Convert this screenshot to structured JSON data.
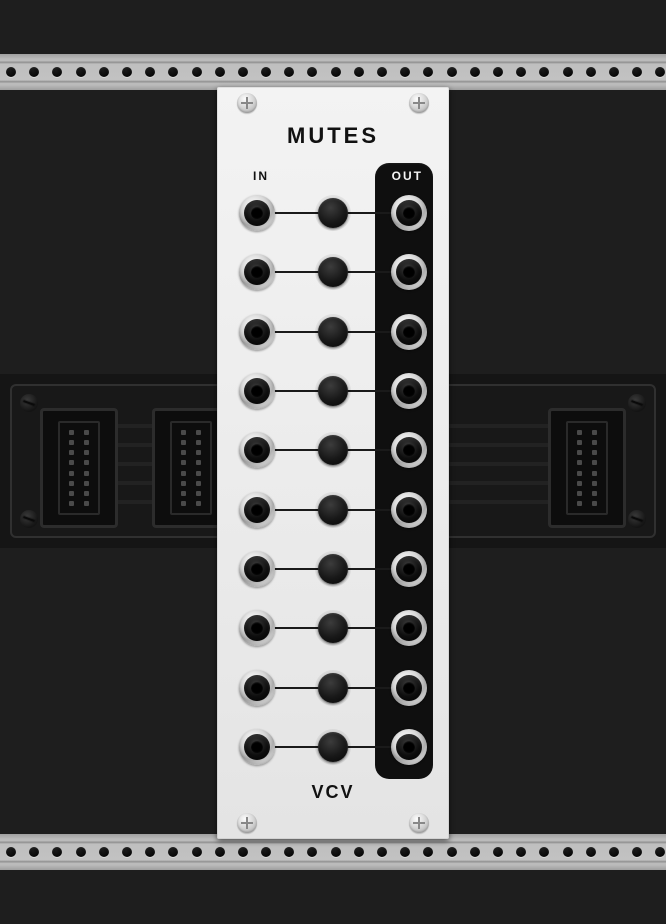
{
  "module": {
    "title": "MUTES",
    "brand": "VCV",
    "labels": {
      "in": "IN",
      "out": "OUT"
    },
    "channels": 10,
    "rows": [
      {
        "index": 1,
        "muted": false
      },
      {
        "index": 2,
        "muted": false
      },
      {
        "index": 3,
        "muted": false
      },
      {
        "index": 4,
        "muted": false
      },
      {
        "index": 5,
        "muted": false
      },
      {
        "index": 6,
        "muted": false
      },
      {
        "index": 7,
        "muted": false
      },
      {
        "index": 8,
        "muted": false
      },
      {
        "index": 9,
        "muted": false
      },
      {
        "index": 10,
        "muted": false
      }
    ]
  },
  "colors": {
    "panel": "#ececec",
    "out_panel": "#0f0f0f",
    "background": "#1e1e1e"
  },
  "rack": {
    "rail_hole_count": 29,
    "busboard_connector_pins": 16
  }
}
